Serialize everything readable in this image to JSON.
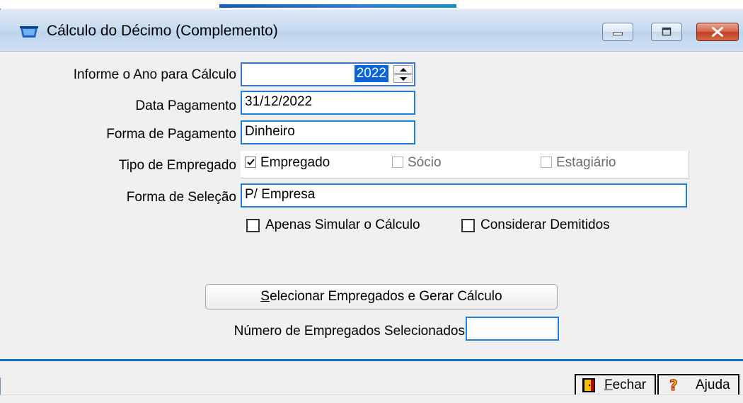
{
  "window": {
    "title": "Cálculo do Décimo (Complemento)"
  },
  "form": {
    "ano_label": "Informe o Ano para Cálculo",
    "ano_value": "2022",
    "data_pagamento_label": "Data Pagamento",
    "data_pagamento_value": "31/12/2022",
    "forma_pagamento_label": "Forma de Pagamento",
    "forma_pagamento_value": "Dinheiro",
    "tipo_empregado_label": "Tipo de Empregado",
    "tipo_options": [
      {
        "label": "Empregado",
        "checked": true,
        "enabled": true
      },
      {
        "label": "Sócio",
        "checked": false,
        "enabled": false
      },
      {
        "label": "Estagiário",
        "checked": false,
        "enabled": false
      }
    ],
    "forma_selecao_label": "Forma de Seleção",
    "forma_selecao_value": "P/ Empresa",
    "simular_label": "Apenas Simular o Cálculo",
    "simular_checked": false,
    "demitidos_label": "Considerar Demitidos",
    "demitidos_checked": false,
    "selecionar_button_first": "S",
    "selecionar_button_rest": "elecionar Empregados e Gerar Cálculo",
    "numero_label": "Número de Empregados Selecionados",
    "numero_value": ""
  },
  "footer": {
    "fechar_first": "F",
    "fechar_rest": "echar",
    "ajuda_label": "Ajuda"
  },
  "colors": {
    "accent": "#1c7fd8",
    "selection": "#0a64d8",
    "close_button": "#c1401f"
  }
}
